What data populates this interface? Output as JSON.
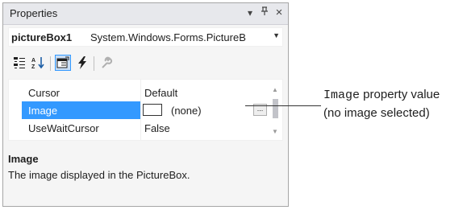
{
  "panel": {
    "title": "Properties",
    "menu_icon": "dropdown-arrow-icon",
    "pin_icon": "pin-icon",
    "close_icon": "close-icon"
  },
  "object_selector": {
    "name": "pictureBox1",
    "type": "System.Windows.Forms.PictureB"
  },
  "toolbar": {
    "tools": [
      {
        "icon": "categorized-icon",
        "active": false
      },
      {
        "icon": "alphabetical-icon",
        "active": false
      },
      {
        "icon": "properties-icon",
        "active": true
      },
      {
        "icon": "events-icon",
        "active": false
      },
      {
        "icon": "property-pages-icon",
        "active": false
      }
    ]
  },
  "grid": {
    "rows": [
      {
        "name": "Cursor",
        "value": "Default",
        "selected": false
      },
      {
        "name": "Image",
        "value": "(none)",
        "selected": true
      },
      {
        "name": "UseWaitCursor",
        "value": "False",
        "selected": false
      }
    ],
    "ellipsis_label": "..."
  },
  "description": {
    "title": "Image",
    "text": "The image displayed in the PictureBox."
  },
  "callout": {
    "code": "Image",
    "line1_rest": " property value",
    "line2": "(no image selected)"
  },
  "colors": {
    "selection": "#3399ff",
    "titlebar": "#e7e8ec"
  }
}
